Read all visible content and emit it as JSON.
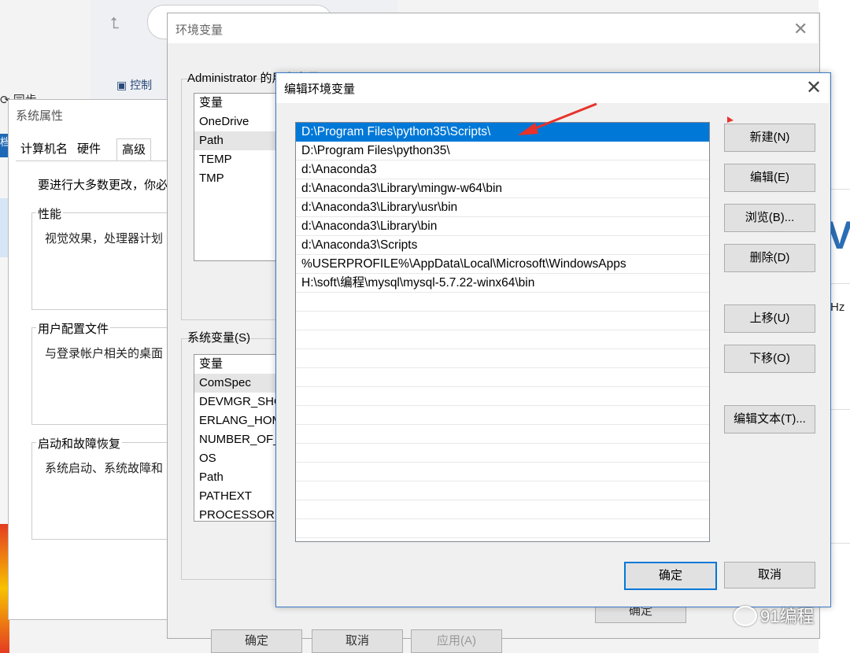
{
  "background": {
    "control_panel": "控制",
    "sync": "同步",
    "right_hz": "Hz",
    "right_v": "V",
    "left_tab": "档"
  },
  "system_properties": {
    "title": "系统属性",
    "tabs": [
      "计算机名",
      "硬件",
      "高级"
    ],
    "note": "要进行大多数更改，你必",
    "groups": [
      {
        "label": "性能",
        "text": "视觉效果，处理器计划"
      },
      {
        "label": "用户配置文件",
        "text": "与登录帐户相关的桌面"
      },
      {
        "label": "启动和故障恢复",
        "text": "系统启动、系统故障和"
      }
    ]
  },
  "env_vars": {
    "title": "环境变量",
    "user_vars_label": "Administrator 的用户变量(U)",
    "user_vars_header": "变量",
    "user_vars": [
      "OneDrive",
      "Path",
      "TEMP",
      "TMP"
    ],
    "sys_vars_label": "系统变量(S)",
    "sys_vars_header": "变量",
    "sys_vars": [
      "ComSpec",
      "DEVMGR_SHOW",
      "ERLANG_HOME",
      "NUMBER_OF_",
      "OS",
      "Path",
      "PATHEXT",
      "PROCESSOR"
    ],
    "buttons": {
      "ok": "确定",
      "cancel": "取消",
      "apply": "应用(A)",
      "inner_ok": "确定"
    }
  },
  "edit_dialog": {
    "title": "编辑环境变量",
    "paths": [
      "D:\\Program Files\\python35\\Scripts\\",
      "D:\\Program Files\\python35\\",
      "d:\\Anaconda3",
      "d:\\Anaconda3\\Library\\mingw-w64\\bin",
      "d:\\Anaconda3\\Library\\usr\\bin",
      "d:\\Anaconda3\\Library\\bin",
      "d:\\Anaconda3\\Scripts",
      "%USERPROFILE%\\AppData\\Local\\Microsoft\\WindowsApps",
      "H:\\soft\\编程\\mysql\\mysql-5.7.22-winx64\\bin"
    ],
    "selected_index": 0,
    "buttons": {
      "new": "新建(N)",
      "edit": "编辑(E)",
      "browse": "浏览(B)...",
      "delete": "删除(D)",
      "move_up": "上移(U)",
      "move_down": "下移(O)",
      "edit_text": "编辑文本(T)...",
      "ok": "确定",
      "cancel": "取消"
    },
    "accent": "#0078d7",
    "arrow_color": "#e8322a"
  },
  "watermark": "91编程"
}
